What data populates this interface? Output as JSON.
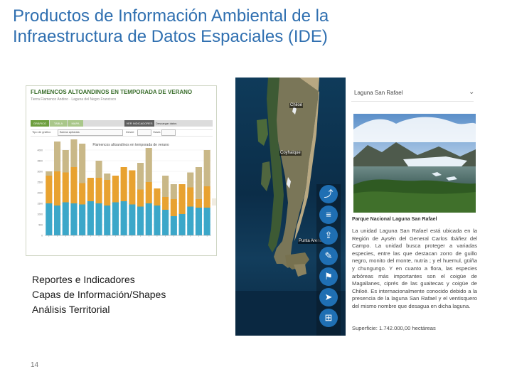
{
  "title": {
    "line1": "Productos de Información Ambiental de la",
    "line2": "Infraestructura de Datos Espaciales (IDE)"
  },
  "chart_panel": {
    "header": "FLAMENCOS ALTOANDINOS EN TEMPORADA DE VERANO",
    "subtitle": "Tierra Flamenco Andino · Laguna del Negro Francisco",
    "tabs": [
      "GRÁFICO",
      "TABLA",
      "MAPA",
      "VER INDICADORES"
    ],
    "toolbar_right": "Descargar datos",
    "filters": [
      "Tipo de gráfico",
      "Barras apiladas",
      "Desde",
      "Hasta"
    ],
    "chart_title": "Flamencos altoandinos en temporada de verano",
    "colors": {
      "teal": "#3ba7c9",
      "orange": "#e8a230",
      "khaki": "#c9b888"
    }
  },
  "chart_data": {
    "type": "bar",
    "stacked": true,
    "title": "Flamencos altoandinos en temporada de verano",
    "ylabel": "",
    "ylim": [
      0,
      4000
    ],
    "categories": [
      "",
      "",
      "",
      "",
      "",
      "",
      "",
      "",
      "",
      "",
      "",
      "",
      "",
      "",
      "",
      "",
      "",
      "",
      "",
      ""
    ],
    "series": [
      {
        "values": [
          1500,
          1400,
          1550,
          1500,
          1450,
          1600,
          1500,
          1400,
          1550,
          1600,
          1450,
          1350,
          1500,
          1400,
          1200,
          900,
          1000,
          1350,
          1300,
          1300
        ]
      },
      {
        "values": [
          1300,
          1600,
          1400,
          1700,
          1000,
          1100,
          1200,
          1200,
          1250,
          1600,
          1600,
          800,
          1000,
          800,
          600,
          800,
          1400,
          900,
          400,
          1000
        ]
      },
      {
        "values": [
          200,
          1400,
          1050,
          1300,
          1850,
          0,
          800,
          300,
          0,
          0,
          0,
          1250,
          1600,
          0,
          1000,
          700,
          0,
          700,
          1500,
          1700
        ]
      }
    ]
  },
  "map_panel": {
    "place_labels": [
      "Chiloé",
      "Coyhaique",
      "Punta Arenas"
    ],
    "tools": [
      {
        "icon": "trend-icon",
        "glyph": "⤴"
      },
      {
        "icon": "layers-icon",
        "glyph": "≡"
      },
      {
        "icon": "upload-icon",
        "glyph": "⇪"
      },
      {
        "icon": "pencil-icon",
        "glyph": "✎"
      },
      {
        "icon": "flag-icon",
        "glyph": "⚑"
      },
      {
        "icon": "navigate-icon",
        "glyph": "➤"
      },
      {
        "icon": "map-icon",
        "glyph": "⊞"
      }
    ],
    "info": {
      "select_value": "Laguna San Rafael",
      "chevron": "⌄",
      "caption": "Parque Nacional Laguna San Rafael",
      "description": "La unidad Laguna San Rafael está ubicada en la Región de Aysén del General Carlos Ibáñez del Campo. La unidad busca proteger a variadas especies, entre las que destacan zorro de guillo negro, monito del monte, nutria ; y el huemul, güiña y chungungo. Y en cuanto a flora, las especies arbóreas más importantes son el coigüe de Magallanes, ciprés de las guaitecas y coigüe de Chiloé. Es internacionalmente conocido debido a la presencia de la laguna San Rafael y el ventisquero del mismo nombre que desagua en dicha laguna.",
      "area": "Superficie: 1.742.000,00 hectáreas"
    }
  },
  "bullets": [
    "Reportes e Indicadores",
    "Capas de Información/Shapes",
    "Análisis Territorial"
  ],
  "page_number": "14"
}
